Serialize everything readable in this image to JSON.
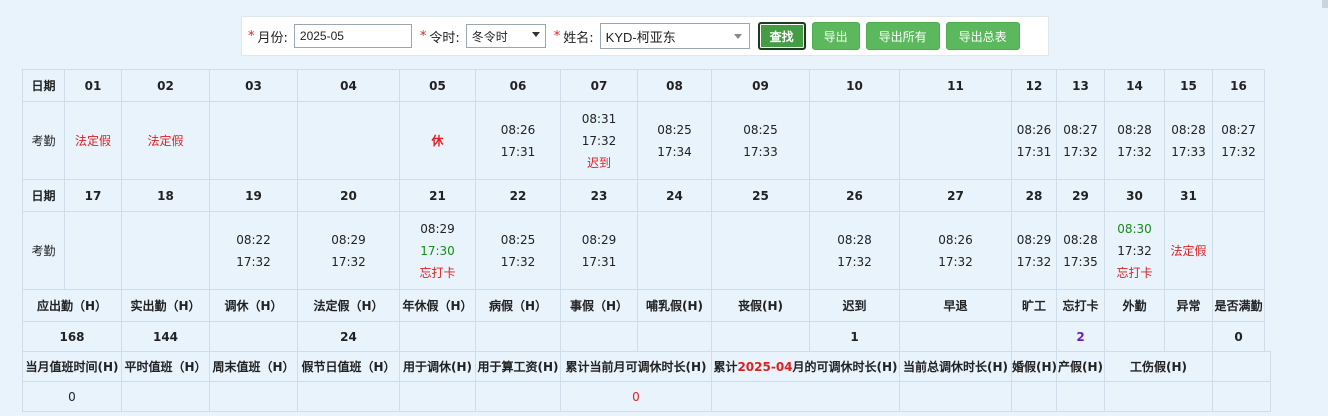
{
  "filter": {
    "month_label": "月份:",
    "month_value": "2025-05",
    "season_label": "令时:",
    "season_value": "冬令时",
    "name_label": "姓名:",
    "name_value": "KYD-柯亚东",
    "buttons": {
      "search": "查找",
      "export": "导出",
      "export_all": "导出所有",
      "export_summary": "导出总表"
    }
  },
  "row_labels": {
    "date": "日期",
    "attendance": "考勤"
  },
  "week1": {
    "days": [
      "01",
      "02",
      "03",
      "04",
      "05",
      "06",
      "07",
      "08",
      "09",
      "10",
      "11",
      "12",
      "13",
      "14",
      "15",
      "16"
    ],
    "att": [
      {
        "lines": [
          {
            "t": "法定假",
            "c": "red"
          }
        ]
      },
      {
        "lines": [
          {
            "t": "法定假",
            "c": "red"
          }
        ]
      },
      {
        "lines": []
      },
      {
        "lines": []
      },
      {
        "lines": [
          {
            "t": "休",
            "c": "red-bold"
          }
        ]
      },
      {
        "lines": [
          {
            "t": "08:26",
            "c": ""
          },
          {
            "t": "17:31",
            "c": ""
          }
        ]
      },
      {
        "lines": [
          {
            "t": "08:31",
            "c": ""
          },
          {
            "t": "17:32",
            "c": ""
          },
          {
            "t": "迟到",
            "c": "red"
          }
        ]
      },
      {
        "lines": [
          {
            "t": "08:25",
            "c": ""
          },
          {
            "t": "17:34",
            "c": ""
          }
        ]
      },
      {
        "lines": [
          {
            "t": "08:25",
            "c": ""
          },
          {
            "t": "17:33",
            "c": ""
          }
        ]
      },
      {
        "lines": []
      },
      {
        "lines": []
      },
      {
        "lines": [
          {
            "t": "08:26",
            "c": ""
          },
          {
            "t": "17:31",
            "c": ""
          }
        ]
      },
      {
        "lines": [
          {
            "t": "08:27",
            "c": ""
          },
          {
            "t": "17:32",
            "c": ""
          }
        ]
      },
      {
        "lines": [
          {
            "t": "08:28",
            "c": ""
          },
          {
            "t": "17:32",
            "c": ""
          }
        ]
      },
      {
        "lines": [
          {
            "t": "08:28",
            "c": ""
          },
          {
            "t": "17:33",
            "c": ""
          }
        ]
      },
      {
        "lines": [
          {
            "t": "08:27",
            "c": ""
          },
          {
            "t": "17:32",
            "c": ""
          }
        ]
      }
    ]
  },
  "week2": {
    "days": [
      "17",
      "18",
      "19",
      "20",
      "21",
      "22",
      "23",
      "24",
      "25",
      "26",
      "27",
      "28",
      "29",
      "30",
      "31",
      ""
    ],
    "att": [
      {
        "lines": []
      },
      {
        "lines": []
      },
      {
        "lines": [
          {
            "t": "08:22",
            "c": ""
          },
          {
            "t": "17:32",
            "c": ""
          }
        ]
      },
      {
        "lines": [
          {
            "t": "08:29",
            "c": ""
          },
          {
            "t": "17:32",
            "c": ""
          }
        ]
      },
      {
        "lines": [
          {
            "t": "08:29",
            "c": ""
          },
          {
            "t": "17:30",
            "c": "green"
          },
          {
            "t": "忘打卡",
            "c": "red"
          }
        ]
      },
      {
        "lines": [
          {
            "t": "08:25",
            "c": ""
          },
          {
            "t": "17:32",
            "c": ""
          }
        ]
      },
      {
        "lines": [
          {
            "t": "08:29",
            "c": ""
          },
          {
            "t": "17:31",
            "c": ""
          }
        ]
      },
      {
        "lines": []
      },
      {
        "lines": []
      },
      {
        "lines": [
          {
            "t": "08:28",
            "c": ""
          },
          {
            "t": "17:32",
            "c": ""
          }
        ]
      },
      {
        "lines": [
          {
            "t": "08:26",
            "c": ""
          },
          {
            "t": "17:32",
            "c": ""
          }
        ]
      },
      {
        "lines": [
          {
            "t": "08:29",
            "c": ""
          },
          {
            "t": "17:32",
            "c": ""
          }
        ]
      },
      {
        "lines": [
          {
            "t": "08:28",
            "c": ""
          },
          {
            "t": "17:35",
            "c": ""
          }
        ]
      },
      {
        "lines": [
          {
            "t": "08:30",
            "c": "green"
          },
          {
            "t": "17:32",
            "c": ""
          },
          {
            "t": "忘打卡",
            "c": "red"
          }
        ]
      },
      {
        "lines": [
          {
            "t": "法定假",
            "c": "red"
          }
        ]
      },
      {
        "lines": []
      }
    ]
  },
  "summary1": {
    "headers": [
      "应出勤（H）",
      "实出勤（H）",
      "调休（H）",
      "法定假（H）",
      "年休假（H）",
      "病假（H）",
      "事假（H）",
      "哺乳假(H)",
      "丧假(H)",
      "迟到",
      "早退",
      "旷工",
      "忘打卡",
      "外勤",
      "异常",
      "是否满勤"
    ],
    "values": [
      "168",
      "144",
      "",
      "24",
      "",
      "",
      "",
      "",
      "",
      "1",
      "",
      "",
      "2",
      "",
      "",
      "0"
    ]
  },
  "summary2": {
    "headers": [
      "当月值班时间(H)",
      "平时值班（H）",
      "周末值班（H）",
      "假节日值班（H）",
      "用于调休(H)",
      "用于算工资(H)",
      "累计当前月可调休时长(H)",
      "",
      "当前总调休时长(H)",
      "婚假(H)",
      "产假(H)",
      "工伤假(H)",
      "",
      ""
    ],
    "cumulative_prefix": "累计",
    "cumulative_month": "2025-04",
    "cumulative_suffix": "月的可调休时长(H)",
    "values_first": "0",
    "values_mid": "0"
  }
}
